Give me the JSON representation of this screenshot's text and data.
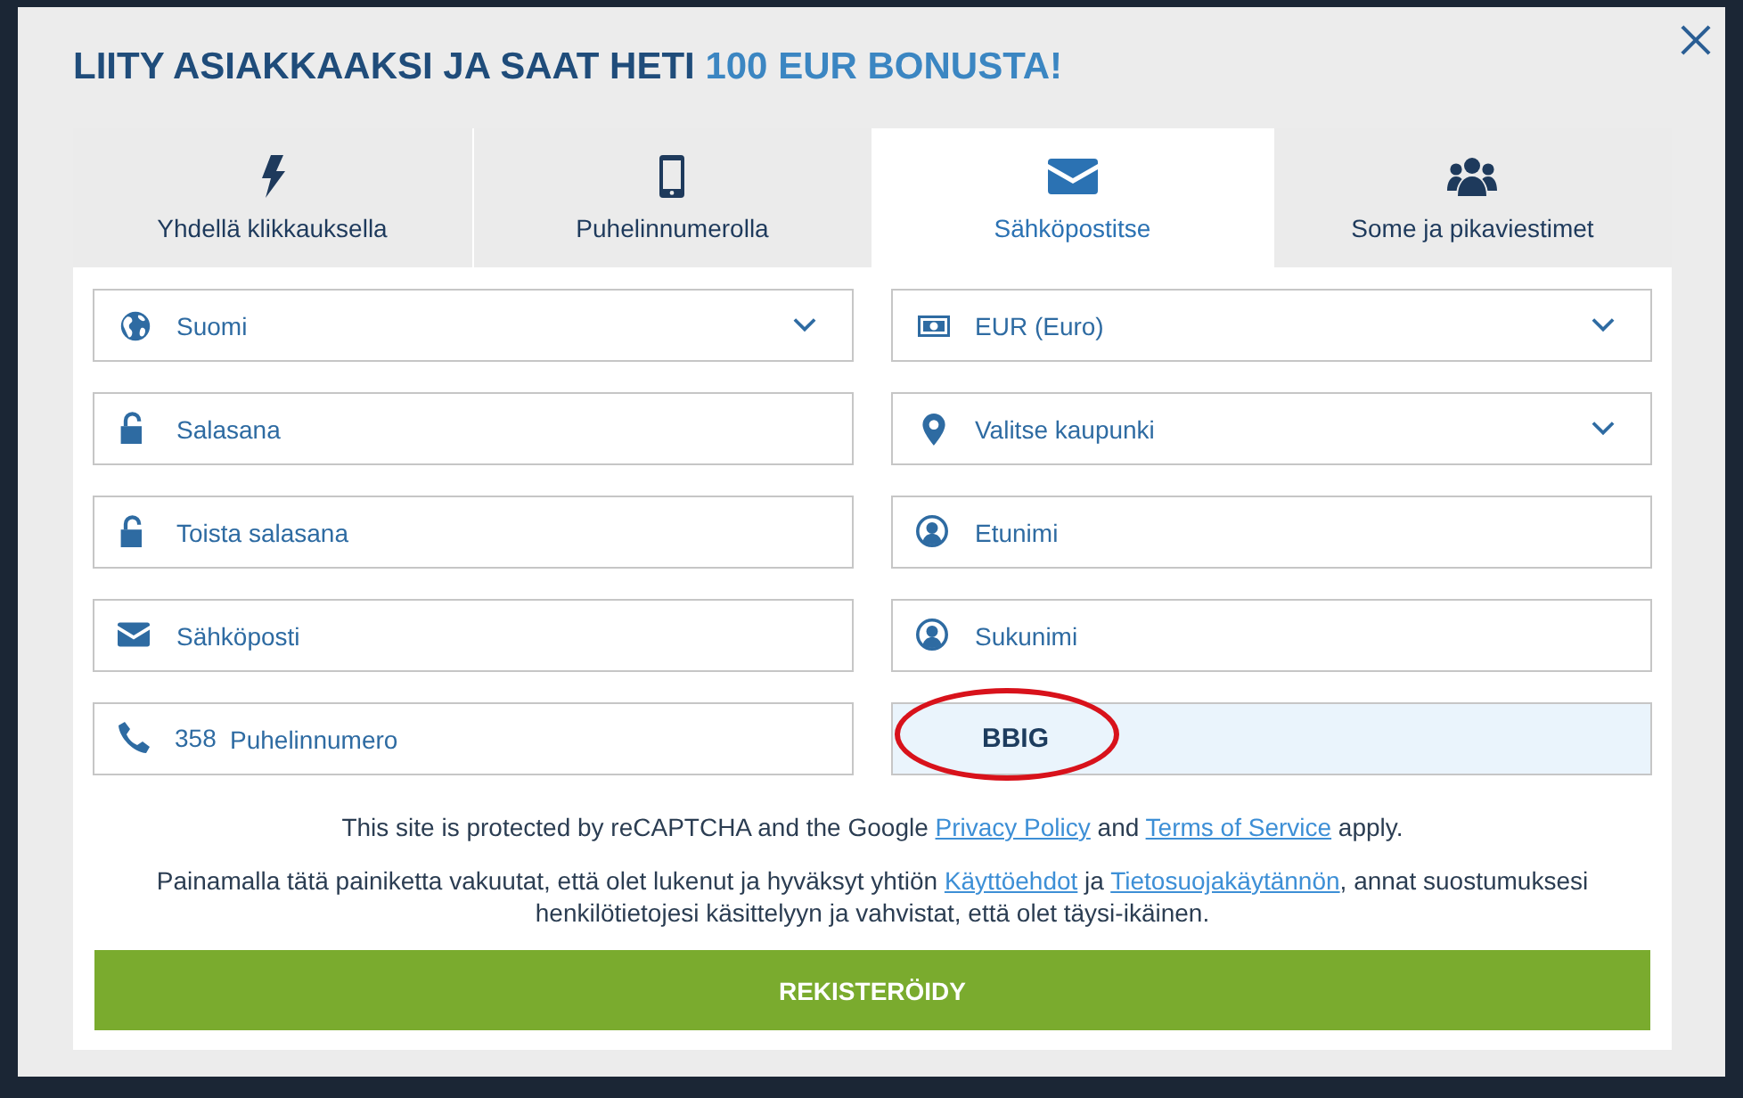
{
  "dialog": {
    "title": "LIITY ASIAKKAAKSI JA SAAT HETI",
    "title_highlight": "100 EUR BONUSTA!"
  },
  "tabs": [
    {
      "label": "Yhdellä klikkauksella",
      "selected": false
    },
    {
      "label": "Puhelinnumerolla",
      "selected": false
    },
    {
      "label": "Sähköpostitse",
      "selected": true
    },
    {
      "label": "Some ja pikaviestimet",
      "selected": false
    }
  ],
  "fields": [
    {
      "kind": "select",
      "placeholder": "Suomi"
    },
    {
      "kind": "select",
      "placeholder": "EUR (Euro)"
    },
    {
      "kind": "password",
      "placeholder": "Salasana"
    },
    {
      "kind": "select",
      "placeholder": "Valitse kaupunki"
    },
    {
      "kind": "password",
      "placeholder": "Toista salasana"
    },
    {
      "kind": "text",
      "placeholder": "Etunimi"
    },
    {
      "kind": "text",
      "placeholder": "Sähköposti"
    },
    {
      "kind": "text",
      "placeholder": "Sukunimi"
    },
    {
      "kind": "phone",
      "prefix": "358",
      "placeholder": "Puhelinnumero"
    },
    {
      "kind": "code",
      "value": "BBIG",
      "circled": true
    }
  ],
  "notices": [
    [
      {
        "text": "This site is protected by reCAPTCHA and the Google "
      },
      {
        "link": "Privacy Policy"
      },
      {
        "text": " and "
      },
      {
        "link": "Terms of Service"
      },
      {
        "text": " apply."
      }
    ],
    [
      {
        "text": "Painamalla tätä painiketta vakuutat, että olet lukenut ja hyväksyt yhtiön "
      },
      {
        "link": "Käyttöehdot"
      },
      {
        "text": " ja "
      },
      {
        "link": "Tietosuojakäytännön"
      },
      {
        "text": ", annat suostumuksesi henkilötietojesi käsittelyyn ja vahvistat, että olet täysi-ikäinen."
      }
    ]
  ],
  "submit": "REKISTERÖIDY"
}
